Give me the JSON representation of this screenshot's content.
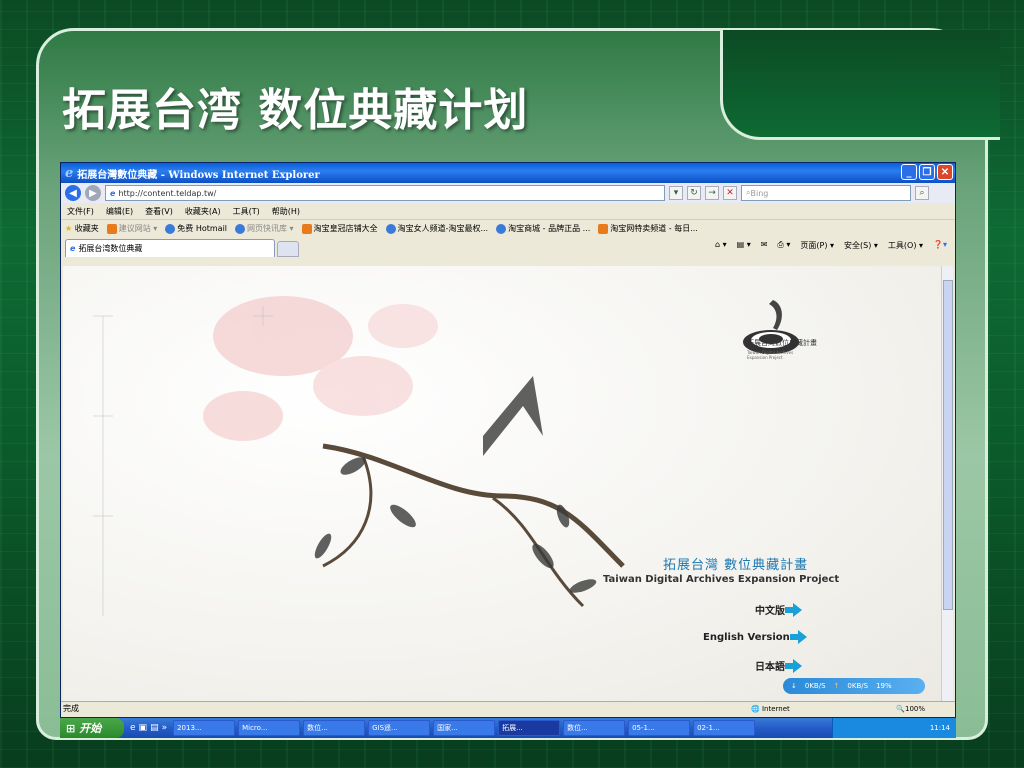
{
  "slide": {
    "title": "拓展台湾  数位典藏计划"
  },
  "ie": {
    "window_title": "拓展台灣數位典藏 - Windows Internet Explorer",
    "address": "http://content.teldap.tw/",
    "search_placeholder": "Bing",
    "menu": [
      "文件(F)",
      "编辑(E)",
      "查看(V)",
      "收藏夹(A)",
      "工具(T)",
      "帮助(H)"
    ],
    "favorites_label": "收藏夹",
    "favorites": [
      "建议网站 ▾",
      "免费 Hotmail",
      "网页快讯库 ▾",
      "淘宝皇冠店铺大全",
      "淘宝女人频道-淘宝最权...",
      "淘宝商城 - 品牌正品 ...",
      "淘宝网特卖频道 - 每日..."
    ],
    "tab_label": "拓展台湾数位典藏",
    "cmdbar": [
      "页面(P) ▾",
      "安全(S) ▾",
      "工具(O) ▾"
    ],
    "status_text": "完成",
    "zone": "Internet",
    "zoom": "100%"
  },
  "site": {
    "logo_text": "拓展台灣數位典藏計畫",
    "logo_sub1": "Taiwan Digital Archives",
    "logo_sub2": "Expansion Project",
    "brand_cn": "拓展台灣  數位典藏計畫",
    "brand_en": "Taiwan Digital Archives Expansion Project",
    "langs": [
      "中文版",
      "English Version",
      "日本語"
    ],
    "speed_down": "0KB/S",
    "speed_up": "0KB/S",
    "speed_pct": "19%"
  },
  "taskbar": {
    "start": "开始",
    "items": [
      "2013...",
      "Micro...",
      "数位...",
      "GIS遥...",
      "国家...",
      "拓展...",
      "数位...",
      "05-1...",
      "02-1..."
    ],
    "clock": "11:14"
  }
}
